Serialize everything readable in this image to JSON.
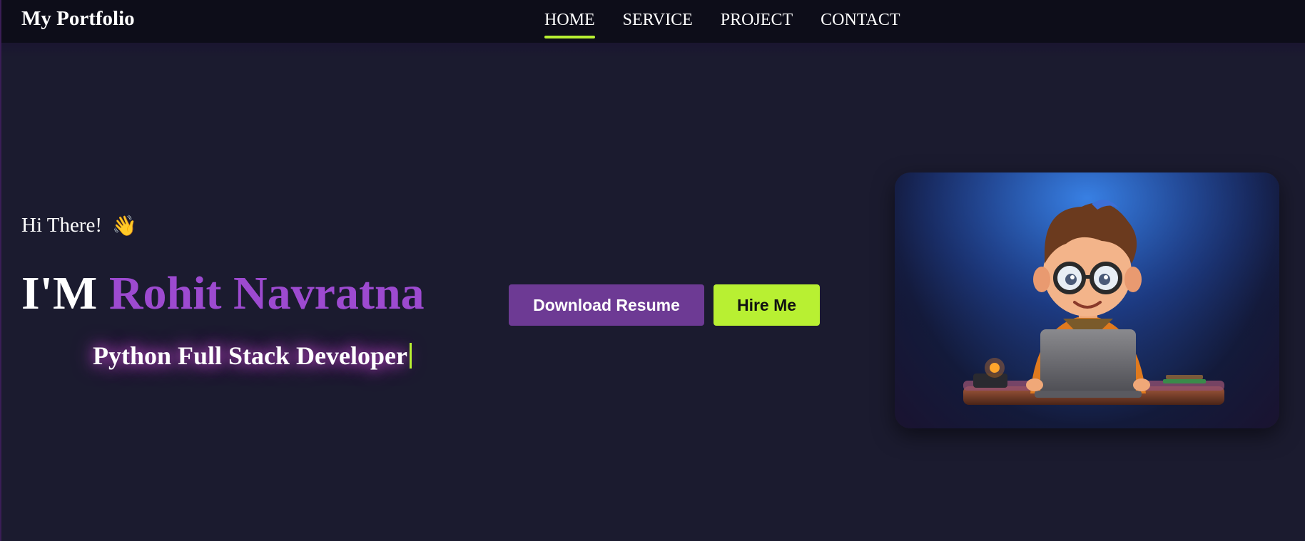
{
  "navbar": {
    "brand": "My Portfolio",
    "links": [
      {
        "label": "HOME",
        "active": true
      },
      {
        "label": "SERVICE",
        "active": false
      },
      {
        "label": "PROJECT",
        "active": false
      },
      {
        "label": "CONTACT",
        "active": false
      }
    ]
  },
  "hero": {
    "greeting": "Hi There!",
    "wave_icon": "waving-hand-icon",
    "headline_prefix": "I'M",
    "name": "Rohit Navratna",
    "role": "Python Full Stack Developer",
    "illustration": "developer-avatar-illustration"
  },
  "buttons": {
    "download_label": "Download Resume",
    "hire_label": "Hire Me"
  },
  "colors": {
    "background": "#1b1b2f",
    "navbar": "#0d0d19",
    "accent_green": "#b8f032",
    "accent_purple": "#9d4ad0",
    "button_purple": "#6d3a94"
  }
}
